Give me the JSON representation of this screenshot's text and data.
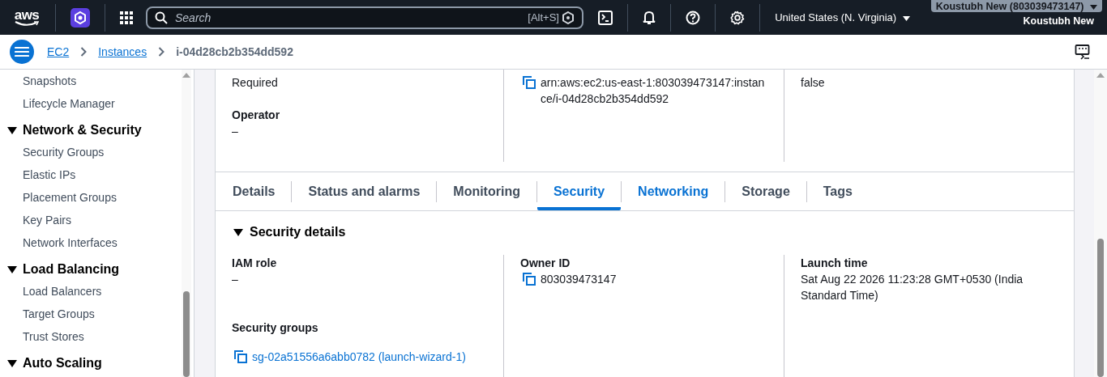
{
  "top_nav": {
    "logo": "aws",
    "search": {
      "placeholder": "Search"
    },
    "shortcut": "[Alt+S]",
    "region": "United States (N. Virginia)",
    "account": "Koustubh New (803039473147)",
    "user": "Koustubh New"
  },
  "breadcrumbs": [
    {
      "label": "EC2",
      "link": true
    },
    {
      "label": "Instances",
      "link": true
    },
    {
      "label": "i-04d28cb2b354dd592",
      "link": false
    }
  ],
  "sidebar": {
    "items": [
      {
        "kind": "link",
        "label": "Snapshots"
      },
      {
        "kind": "link",
        "label": "Lifecycle Manager"
      },
      {
        "kind": "section",
        "label": "Network & Security",
        "expanded": true
      },
      {
        "kind": "link",
        "label": "Security Groups"
      },
      {
        "kind": "link",
        "label": "Elastic IPs"
      },
      {
        "kind": "link",
        "label": "Placement Groups"
      },
      {
        "kind": "link",
        "label": "Key Pairs"
      },
      {
        "kind": "link",
        "label": "Network Interfaces"
      },
      {
        "kind": "section",
        "label": "Load Balancing",
        "expanded": true
      },
      {
        "kind": "link",
        "label": "Load Balancers"
      },
      {
        "kind": "link",
        "label": "Target Groups"
      },
      {
        "kind": "link",
        "label": "Trust Stores"
      },
      {
        "kind": "section",
        "label": "Auto Scaling",
        "expanded": true
      }
    ]
  },
  "summary": {
    "columns": [
      [
        {
          "value": "Required",
          "copyable": false
        },
        {
          "label": "Operator",
          "value": "–",
          "copyable": false
        }
      ],
      [
        {
          "value": "arn:aws:ec2:us-east-1:803039473147:instance/i-04d28cb2b354dd592",
          "copyable": true
        }
      ],
      [
        {
          "value": "false",
          "copyable": false
        }
      ]
    ]
  },
  "tabs": [
    {
      "label": "Details",
      "selected": false,
      "hovered": false
    },
    {
      "label": "Status and alarms",
      "selected": false,
      "hovered": false
    },
    {
      "label": "Monitoring",
      "selected": false,
      "hovered": false
    },
    {
      "label": "Security",
      "selected": true,
      "hovered": false
    },
    {
      "label": "Networking",
      "selected": false,
      "hovered": true
    },
    {
      "label": "Storage",
      "selected": false,
      "hovered": false
    },
    {
      "label": "Tags",
      "selected": false,
      "hovered": false
    }
  ],
  "security_details": {
    "title": "Security details",
    "expanded": true,
    "columns": [
      [
        {
          "label": "IAM role",
          "value": "–",
          "copyable": false,
          "link": false
        },
        {
          "label": "Security groups",
          "value": "sg-02a51556a6abb0782 (launch-wizard-1)",
          "copyable": true,
          "link": true
        }
      ],
      [
        {
          "label": "Owner ID",
          "value": "803039473147",
          "copyable": true,
          "link": false
        }
      ],
      [
        {
          "label": "Launch time",
          "value": "Sat Aug 22 2026 11:23:28 GMT+0530 (India Standard Time)",
          "copyable": false,
          "link": false
        }
      ]
    ]
  }
}
